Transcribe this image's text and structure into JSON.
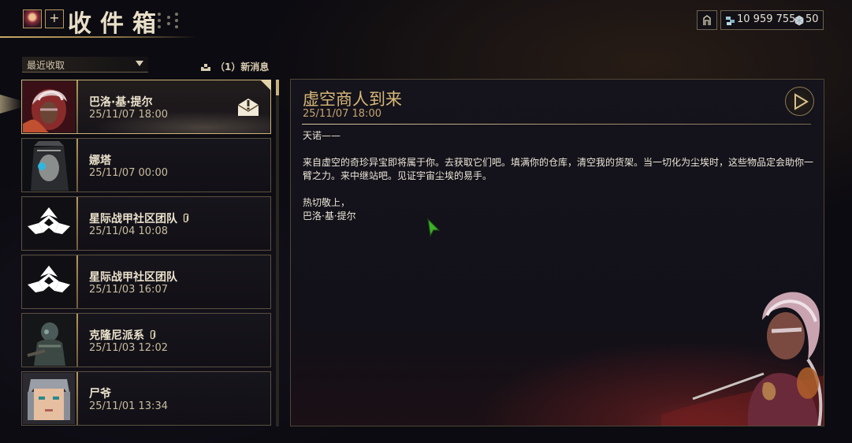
{
  "header": {
    "title": "收件箱",
    "add_label": "+",
    "credits": "10 959 755",
    "platinum": "50"
  },
  "controls": {
    "sort_selected": "最近收取",
    "new_messages": "（1）新消息"
  },
  "mail_list": [
    {
      "sender": "巴洛·基·提尔",
      "date": "25/11/07 18:00",
      "selected": true,
      "unread": true,
      "attachment": false,
      "avatar": "baro-portrait"
    },
    {
      "sender": "娜塔",
      "date": "25/11/07 00:00",
      "selected": false,
      "unread": false,
      "attachment": false,
      "avatar": "natah-portrait"
    },
    {
      "sender": "星际战甲社区团队",
      "date": "25/11/04 10:08",
      "selected": false,
      "unread": false,
      "attachment": true,
      "avatar": "lotus-logo"
    },
    {
      "sender": "星际战甲社区团队",
      "date": "25/11/03 16:07",
      "selected": false,
      "unread": false,
      "attachment": false,
      "avatar": "lotus-logo"
    },
    {
      "sender": "克隆尼派系",
      "date": "25/11/03 12:02",
      "selected": false,
      "unread": false,
      "attachment": true,
      "avatar": "grineer-soldier"
    },
    {
      "sender": "尸爷",
      "date": "25/11/01 13:34",
      "selected": false,
      "unread": false,
      "attachment": false,
      "avatar": "pixel-face"
    }
  ],
  "message": {
    "title": "虚空商人到来",
    "date": "25/11/07 18:00",
    "greeting": "天诺——",
    "body": "来自虚空的奇珍异宝即将属于你。去获取它们吧。填满你的仓库，清空我的货架。当一切化为尘埃时，这些物品定会助你一臂之力。来中继站吧。见证宇宙尘埃的易手。",
    "closing": "热切敬上，",
    "signature": "巴洛·基·提尔"
  },
  "colors": {
    "accent_gold": "#cdb27a",
    "title_gold": "#d7b878",
    "panel_bg": "#121018",
    "cursor_green": "#3fae2a"
  },
  "icons": [
    "profile-avatar-icon",
    "mail-unread-icon",
    "attachment-clip-icon",
    "play-icon",
    "credits-icon",
    "platinum-icon",
    "inbox-tray-icon",
    "chevron-down-icon"
  ]
}
